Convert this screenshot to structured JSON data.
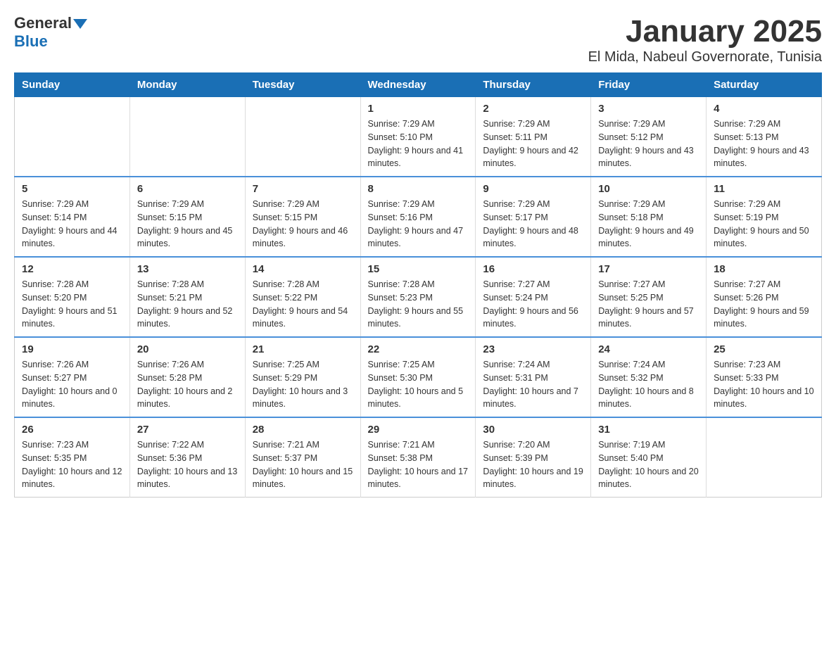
{
  "logo": {
    "general": "General",
    "blue": "Blue"
  },
  "title": "January 2025",
  "subtitle": "El Mida, Nabeul Governorate, Tunisia",
  "days_of_week": [
    "Sunday",
    "Monday",
    "Tuesday",
    "Wednesday",
    "Thursday",
    "Friday",
    "Saturday"
  ],
  "weeks": [
    [
      {
        "day": "",
        "info": ""
      },
      {
        "day": "",
        "info": ""
      },
      {
        "day": "",
        "info": ""
      },
      {
        "day": "1",
        "info": "Sunrise: 7:29 AM\nSunset: 5:10 PM\nDaylight: 9 hours and 41 minutes."
      },
      {
        "day": "2",
        "info": "Sunrise: 7:29 AM\nSunset: 5:11 PM\nDaylight: 9 hours and 42 minutes."
      },
      {
        "day": "3",
        "info": "Sunrise: 7:29 AM\nSunset: 5:12 PM\nDaylight: 9 hours and 43 minutes."
      },
      {
        "day": "4",
        "info": "Sunrise: 7:29 AM\nSunset: 5:13 PM\nDaylight: 9 hours and 43 minutes."
      }
    ],
    [
      {
        "day": "5",
        "info": "Sunrise: 7:29 AM\nSunset: 5:14 PM\nDaylight: 9 hours and 44 minutes."
      },
      {
        "day": "6",
        "info": "Sunrise: 7:29 AM\nSunset: 5:15 PM\nDaylight: 9 hours and 45 minutes."
      },
      {
        "day": "7",
        "info": "Sunrise: 7:29 AM\nSunset: 5:15 PM\nDaylight: 9 hours and 46 minutes."
      },
      {
        "day": "8",
        "info": "Sunrise: 7:29 AM\nSunset: 5:16 PM\nDaylight: 9 hours and 47 minutes."
      },
      {
        "day": "9",
        "info": "Sunrise: 7:29 AM\nSunset: 5:17 PM\nDaylight: 9 hours and 48 minutes."
      },
      {
        "day": "10",
        "info": "Sunrise: 7:29 AM\nSunset: 5:18 PM\nDaylight: 9 hours and 49 minutes."
      },
      {
        "day": "11",
        "info": "Sunrise: 7:29 AM\nSunset: 5:19 PM\nDaylight: 9 hours and 50 minutes."
      }
    ],
    [
      {
        "day": "12",
        "info": "Sunrise: 7:28 AM\nSunset: 5:20 PM\nDaylight: 9 hours and 51 minutes."
      },
      {
        "day": "13",
        "info": "Sunrise: 7:28 AM\nSunset: 5:21 PM\nDaylight: 9 hours and 52 minutes."
      },
      {
        "day": "14",
        "info": "Sunrise: 7:28 AM\nSunset: 5:22 PM\nDaylight: 9 hours and 54 minutes."
      },
      {
        "day": "15",
        "info": "Sunrise: 7:28 AM\nSunset: 5:23 PM\nDaylight: 9 hours and 55 minutes."
      },
      {
        "day": "16",
        "info": "Sunrise: 7:27 AM\nSunset: 5:24 PM\nDaylight: 9 hours and 56 minutes."
      },
      {
        "day": "17",
        "info": "Sunrise: 7:27 AM\nSunset: 5:25 PM\nDaylight: 9 hours and 57 minutes."
      },
      {
        "day": "18",
        "info": "Sunrise: 7:27 AM\nSunset: 5:26 PM\nDaylight: 9 hours and 59 minutes."
      }
    ],
    [
      {
        "day": "19",
        "info": "Sunrise: 7:26 AM\nSunset: 5:27 PM\nDaylight: 10 hours and 0 minutes."
      },
      {
        "day": "20",
        "info": "Sunrise: 7:26 AM\nSunset: 5:28 PM\nDaylight: 10 hours and 2 minutes."
      },
      {
        "day": "21",
        "info": "Sunrise: 7:25 AM\nSunset: 5:29 PM\nDaylight: 10 hours and 3 minutes."
      },
      {
        "day": "22",
        "info": "Sunrise: 7:25 AM\nSunset: 5:30 PM\nDaylight: 10 hours and 5 minutes."
      },
      {
        "day": "23",
        "info": "Sunrise: 7:24 AM\nSunset: 5:31 PM\nDaylight: 10 hours and 7 minutes."
      },
      {
        "day": "24",
        "info": "Sunrise: 7:24 AM\nSunset: 5:32 PM\nDaylight: 10 hours and 8 minutes."
      },
      {
        "day": "25",
        "info": "Sunrise: 7:23 AM\nSunset: 5:33 PM\nDaylight: 10 hours and 10 minutes."
      }
    ],
    [
      {
        "day": "26",
        "info": "Sunrise: 7:23 AM\nSunset: 5:35 PM\nDaylight: 10 hours and 12 minutes."
      },
      {
        "day": "27",
        "info": "Sunrise: 7:22 AM\nSunset: 5:36 PM\nDaylight: 10 hours and 13 minutes."
      },
      {
        "day": "28",
        "info": "Sunrise: 7:21 AM\nSunset: 5:37 PM\nDaylight: 10 hours and 15 minutes."
      },
      {
        "day": "29",
        "info": "Sunrise: 7:21 AM\nSunset: 5:38 PM\nDaylight: 10 hours and 17 minutes."
      },
      {
        "day": "30",
        "info": "Sunrise: 7:20 AM\nSunset: 5:39 PM\nDaylight: 10 hours and 19 minutes."
      },
      {
        "day": "31",
        "info": "Sunrise: 7:19 AM\nSunset: 5:40 PM\nDaylight: 10 hours and 20 minutes."
      },
      {
        "day": "",
        "info": ""
      }
    ]
  ]
}
